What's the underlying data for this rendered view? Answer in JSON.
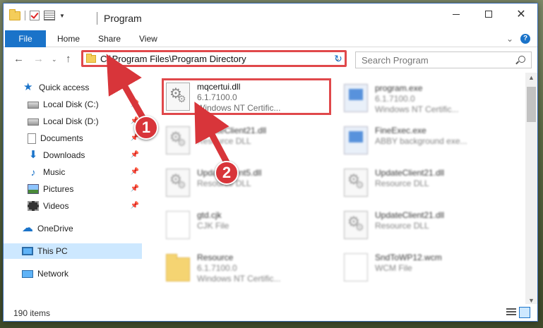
{
  "window": {
    "title": "Program"
  },
  "ribbon": {
    "tabs": [
      "File",
      "Home",
      "Share",
      "View"
    ]
  },
  "nav": {
    "address": "C:\\Program Files\\Program Directory",
    "search_placeholder": "Search Program"
  },
  "sidebar": {
    "items": [
      {
        "label": "Quick access",
        "icon": "star-icon"
      },
      {
        "label": "Local Disk (C:)",
        "icon": "disk-icon",
        "pinned": true
      },
      {
        "label": "Local Disk (D:)",
        "icon": "disk-icon",
        "pinned": true
      },
      {
        "label": "Documents",
        "icon": "documents-icon",
        "pinned": true
      },
      {
        "label": "Downloads",
        "icon": "download-icon",
        "pinned": true
      },
      {
        "label": "Music",
        "icon": "music-icon",
        "pinned": true
      },
      {
        "label": "Pictures",
        "icon": "pictures-icon",
        "pinned": true
      },
      {
        "label": "Videos",
        "icon": "videos-icon",
        "pinned": true
      },
      {
        "label": "OneDrive",
        "icon": "cloud-icon"
      },
      {
        "label": "This PC",
        "icon": "computer-icon",
        "selected": true
      },
      {
        "label": "Network",
        "icon": "network-icon"
      }
    ]
  },
  "files": [
    {
      "name": "mqcertui.dll",
      "line2": "6.1.7100.0",
      "line3": "Windows NT Certific...",
      "icon": "dll-icon",
      "highlighted": true
    },
    {
      "name": "program.exe",
      "line2": "6.1.7100.0",
      "line3": "Windows NT Certific...",
      "icon": "exe-icon"
    },
    {
      "name": "UpdateClient21.dll",
      "line2": "Resource DLL",
      "line3": "",
      "icon": "dll-icon"
    },
    {
      "name": "FineExec.exe",
      "line2": "ABBY background exe...",
      "line3": "",
      "icon": "exe-icon"
    },
    {
      "name": "UpdateClient5.dll",
      "line2": "Resource DLL",
      "line3": "",
      "icon": "dll-icon"
    },
    {
      "name": "UpdateClient21.dll",
      "line2": "Resource DLL",
      "line3": "",
      "icon": "dll-icon"
    },
    {
      "name": "gtd.cjk",
      "line2": "CJK File",
      "line3": "",
      "icon": "file-icon"
    },
    {
      "name": "UpdateClient21.dll",
      "line2": "Resource DLL",
      "line3": "",
      "icon": "dll-icon"
    },
    {
      "name": "Resource",
      "line2": "6.1.7100.0",
      "line3": "Windows NT Certific...",
      "icon": "folder-icon"
    },
    {
      "name": "SndToWP12.wcm",
      "line2": "WCM File",
      "line3": "",
      "icon": "file-icon"
    }
  ],
  "status": {
    "item_count": "190 items"
  },
  "callouts": [
    "1",
    "2"
  ],
  "colors": {
    "accent": "#1a73c9",
    "highlight_border": "#e0484b",
    "callout": "#d8353a"
  }
}
